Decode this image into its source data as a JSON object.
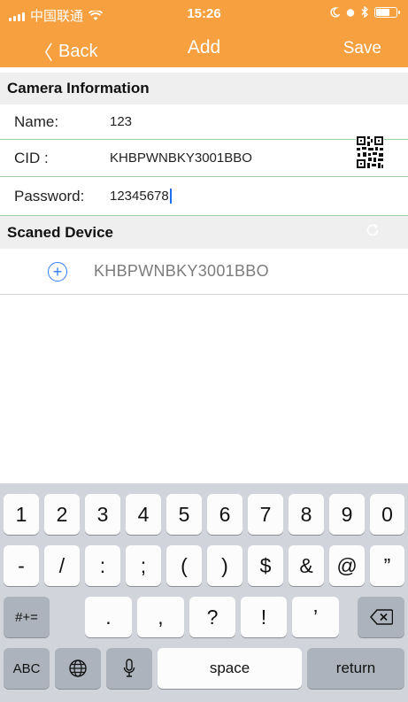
{
  "status_bar": {
    "carrier": "中国联通",
    "time": "15:26",
    "battery_level": 0.6
  },
  "nav": {
    "back_label": "Back",
    "title": "Add",
    "save_label": "Save",
    "back_icon": "chevron-left-icon"
  },
  "camera_info": {
    "header": "Camera Information",
    "fields": [
      {
        "label": "Name:",
        "value": "123"
      },
      {
        "label": "CID :",
        "value": "KHBPWNBKY3001BBO"
      },
      {
        "label": "Password:",
        "value": "12345678"
      }
    ],
    "qr_icon": "qr-code-icon"
  },
  "scanned": {
    "header": "Scaned Device",
    "refresh_icon": "refresh-icon",
    "items": [
      {
        "name": "KHBPWNBKY3001BBO",
        "icon": "plus-circle-icon"
      }
    ]
  },
  "keyboard": {
    "row1": [
      "1",
      "2",
      "3",
      "4",
      "5",
      "6",
      "7",
      "8",
      "9",
      "0"
    ],
    "row2": [
      "-",
      "/",
      ":",
      ";",
      "(",
      ")",
      "$",
      "&",
      "@",
      "”"
    ],
    "row3": {
      "mode": "#+=",
      "keys": [
        ".",
        ",",
        "?",
        "!",
        "’"
      ],
      "delete_icon": "backspace-icon"
    },
    "row4": {
      "abc": "ABC",
      "globe_icon": "globe-icon",
      "mic_icon": "microphone-icon",
      "space": "space",
      "return": "return"
    }
  },
  "colors": {
    "nav_bg": "#f6a040",
    "row_border": "#9bd1a3",
    "accent_blue": "#2f7ef5",
    "keyboard_bg": "#d1d4da"
  }
}
